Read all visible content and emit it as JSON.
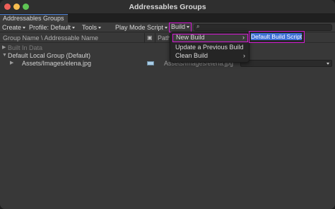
{
  "window": {
    "title": "Addressables Groups"
  },
  "tab": {
    "label": "Addressables Groups"
  },
  "toolbar": {
    "create_label": "Create",
    "profile_label": "Profile: Default",
    "tools_label": "Tools",
    "play_mode_label": "Play Mode Script",
    "build_label": "Build",
    "search_value": ""
  },
  "header": {
    "group_name": "Group Name \\ Addressable Name",
    "path": "Path"
  },
  "rows": [
    {
      "label": "Built In Data"
    },
    {
      "label": "Default Local Group (Default)"
    },
    {
      "label": "Assets/Images/elena.jpg",
      "path": "Assets/Images/elena.jpg"
    }
  ],
  "build_menu": {
    "items": [
      {
        "label": "New Build",
        "submenu_arrow": "›"
      },
      {
        "label": "Update a Previous Build"
      },
      {
        "label": "Clean Build",
        "submenu_arrow": "›"
      }
    ]
  },
  "new_build_submenu": {
    "items": [
      {
        "label": "Default Build Script"
      }
    ]
  },
  "colors": {
    "highlight": "#d61ad6",
    "selection": "#3d6fd6"
  }
}
